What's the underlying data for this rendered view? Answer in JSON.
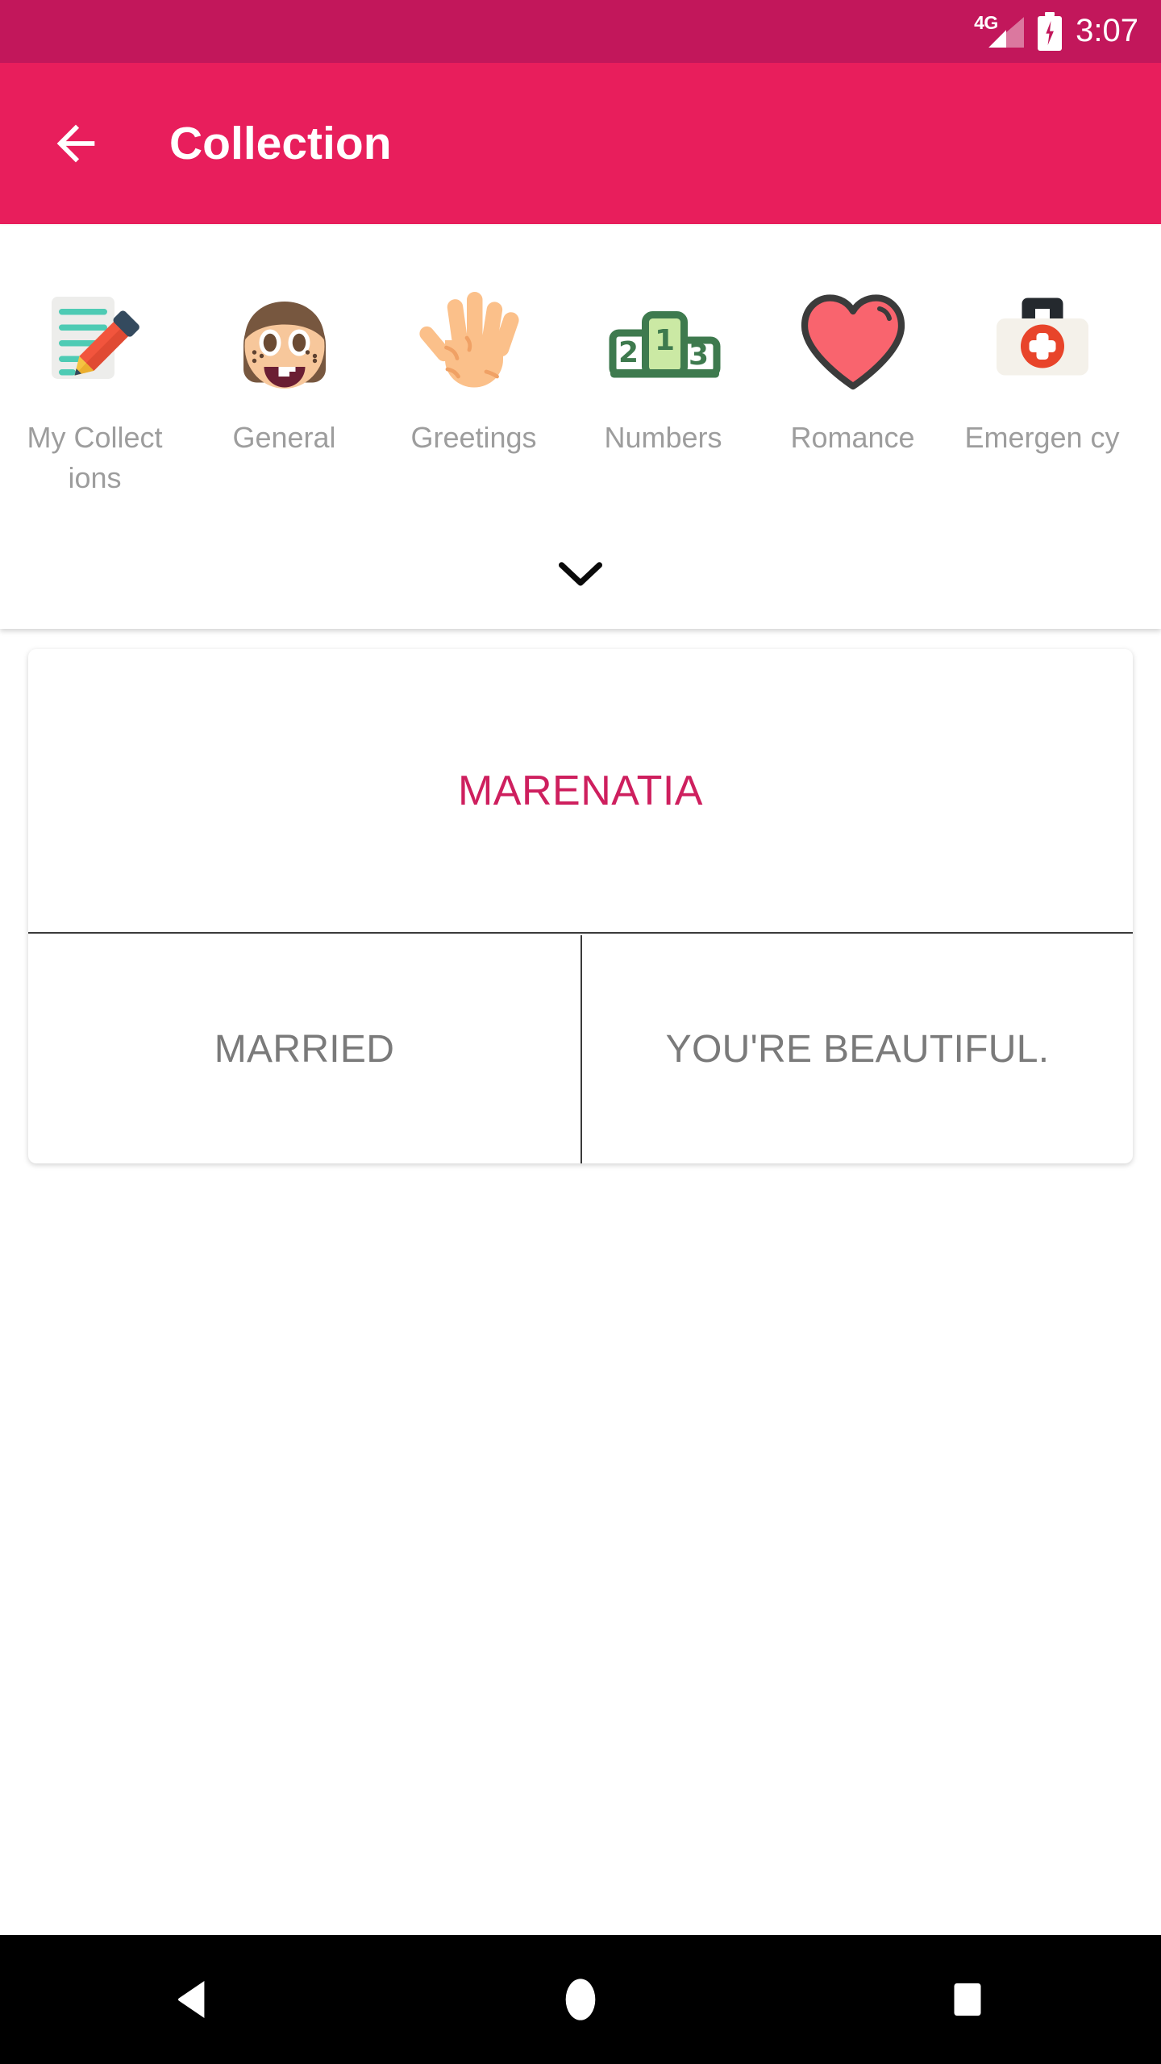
{
  "status_bar": {
    "network_label": "4G",
    "time": "3:07",
    "background_color": "#C2175B",
    "signal_icon": "signal-bars-icon",
    "battery_icon": "battery-charging-icon"
  },
  "app_bar": {
    "title": "Collection",
    "back_icon": "back-arrow-icon",
    "background_color": "#E81E5C",
    "title_color": "#FFFFFF"
  },
  "categories": {
    "expand_icon": "chevron-down-icon",
    "label_color": "#9D9D9D",
    "items": [
      {
        "label": "My Collect ions",
        "icon": "memo-pencil-icon"
      },
      {
        "label": "General",
        "icon": "girl-face-icon"
      },
      {
        "label": "Greetings",
        "icon": "raised-hand-icon"
      },
      {
        "label": "Numbers",
        "icon": "podium-123-icon"
      },
      {
        "label": "Romance",
        "icon": "heart-icon"
      },
      {
        "label": "Emergen cy",
        "icon": "first-aid-kit-icon"
      }
    ]
  },
  "card": {
    "title": "MARENATIA",
    "title_color": "#CE1F5E",
    "cells": [
      {
        "text": "MARRIED"
      },
      {
        "text": "YOU'RE BEAUTIFUL."
      }
    ],
    "cell_text_color": "#7A7A7A"
  },
  "nav_bar": {
    "background_color": "#000000",
    "buttons": [
      {
        "icon": "nav-back-triangle-icon"
      },
      {
        "icon": "nav-home-circle-icon"
      },
      {
        "icon": "nav-recents-square-icon"
      }
    ]
  }
}
